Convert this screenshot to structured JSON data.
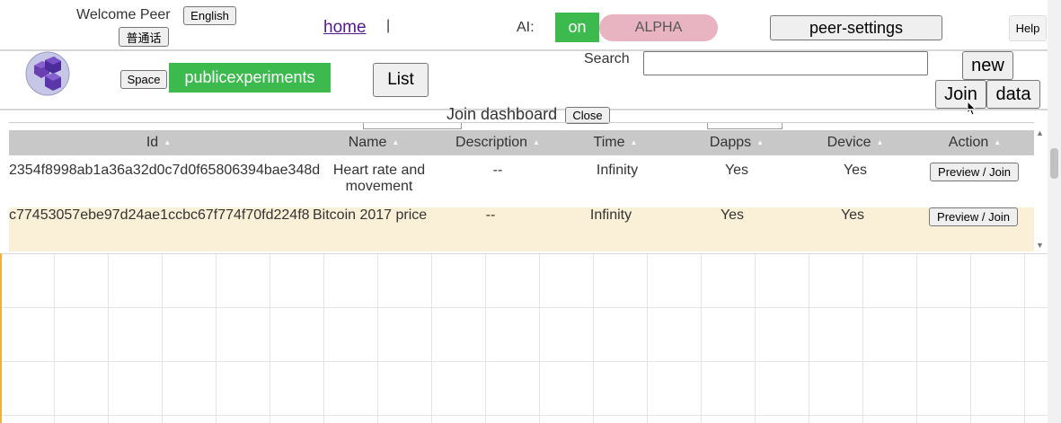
{
  "header": {
    "welcome": "Welcome Peer",
    "lang_english": "English",
    "lang_chinese": "普通话",
    "home": "home",
    "separator": "|",
    "ai_label": "AI:",
    "ai_toggle": "on",
    "alpha": "ALPHA",
    "peer_settings": "peer-settings",
    "help": "Help"
  },
  "toolbar": {
    "space_label": "Space",
    "space_name": "publicexperiments",
    "list": "List",
    "search_label": "Search",
    "search_value": "",
    "new": "new",
    "join": "Join",
    "data": "data"
  },
  "dashboard": {
    "title": "Join dashboard",
    "close": "Close",
    "columns": [
      "Id",
      "Name",
      "Description",
      "Time",
      "Dapps",
      "Device",
      "Action"
    ],
    "rows": [
      {
        "id": "2354f8998ab1a36a32d0c7d0f65806394bae348d",
        "name": "Heart rate and movement",
        "description": "--",
        "time": "Infinity",
        "dapps": "Yes",
        "device": "Yes",
        "action": "Preview / Join"
      },
      {
        "id": "c77453057ebe97d24ae1ccbc67f774f70fd224f8",
        "name": "Bitcoin 2017 price",
        "description": "--",
        "time": "Infinity",
        "dapps": "Yes",
        "device": "Yes",
        "action": "Preview / Join"
      }
    ]
  },
  "colors": {
    "green": "#3cba4e",
    "alpha_pink": "#e8b4c2",
    "header_gray": "#c8c8c8",
    "highlight_row": "#faf0d8",
    "logo_purple": "#6a3fb0"
  },
  "icons": [
    "logo-cubes-icon",
    "cursor-icon",
    "scroll-up-icon",
    "scroll-down-icon"
  ]
}
